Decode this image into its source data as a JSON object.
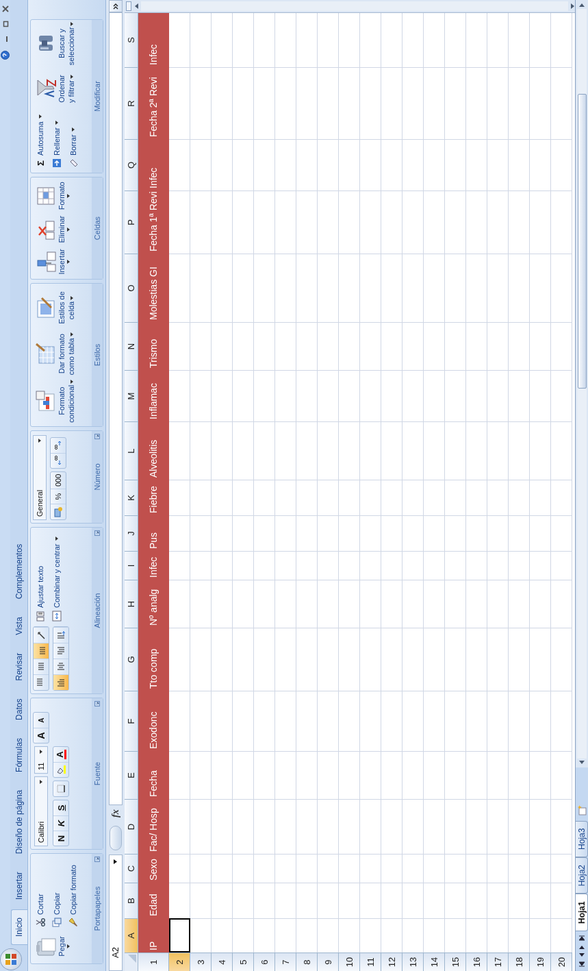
{
  "tabs": [
    {
      "label": "Inicio",
      "selected": true
    },
    {
      "label": "Insertar",
      "selected": false
    },
    {
      "label": "Diseño de página",
      "selected": false
    },
    {
      "label": "Fórmulas",
      "selected": false
    },
    {
      "label": "Datos",
      "selected": false
    },
    {
      "label": "Revisar",
      "selected": false
    },
    {
      "label": "Vista",
      "selected": false
    },
    {
      "label": "Complementos",
      "selected": false
    }
  ],
  "ribbon": {
    "portapapeles": {
      "title": "Portapapeles",
      "launcher": true,
      "paste": "Pegar",
      "items": [
        {
          "kind": "cut",
          "label": "Cortar"
        },
        {
          "kind": "copy",
          "label": "Copiar"
        },
        {
          "kind": "brush",
          "label": "Copiar formato"
        }
      ]
    },
    "fuente": {
      "title": "Fuente",
      "launcher": true,
      "font": "Calibri",
      "size": "11",
      "grow": "A",
      "shrink": "A",
      "styles": [
        {
          "kind": "bold",
          "glyph": "N"
        },
        {
          "kind": "italic",
          "glyph": "K"
        },
        {
          "kind": "underline",
          "glyph": "S"
        }
      ],
      "font_color": "A"
    },
    "alineacion": {
      "title": "Alineación",
      "launcher": true,
      "rows": [
        [
          {
            "kind": "top",
            "selected": false
          },
          {
            "kind": "middle",
            "selected": false
          },
          {
            "kind": "bottom",
            "selected": true
          },
          {
            "kind": "orient",
            "selected": false
          }
        ],
        [
          {
            "kind": "left",
            "selected": true
          },
          {
            "kind": "center",
            "selected": false
          },
          {
            "kind": "right",
            "selected": false
          },
          {
            "kind": "indent",
            "selected": false
          }
        ]
      ],
      "wrap": "Ajustar texto",
      "merge": "Combinar y centrar"
    },
    "numero": {
      "title": "Número",
      "launcher": true,
      "format": "General",
      "percent": "%",
      "thousands": "000"
    },
    "estilos": {
      "title": "Estilos",
      "buttons": [
        {
          "kind": "conditional",
          "lines": [
            "Formato",
            "condicional"
          ]
        },
        {
          "kind": "table",
          "lines": [
            "Dar formato",
            "como tabla"
          ]
        },
        {
          "kind": "cellstyle",
          "lines": [
            "Estilos de",
            "celda"
          ]
        }
      ]
    },
    "celdas": {
      "title": "Celdas",
      "buttons": [
        {
          "kind": "insert",
          "label": "Insertar"
        },
        {
          "kind": "delete",
          "label": "Eliminar"
        },
        {
          "kind": "format",
          "label": "Formato"
        }
      ]
    },
    "modificar": {
      "title": "Modificar",
      "sigma": "Σ",
      "small": [
        {
          "kind": "sum",
          "label": "Autosuma"
        },
        {
          "kind": "fill",
          "label": "Rellenar"
        },
        {
          "kind": "clear",
          "label": "Borrar"
        }
      ],
      "big": [
        {
          "kind": "sort",
          "lines": [
            "Ordenar",
            "y filtrar"
          ]
        },
        {
          "kind": "find",
          "lines": [
            "Buscar y",
            "seleccionar"
          ]
        }
      ]
    }
  },
  "formula_bar": {
    "name_box": "A2",
    "fx": "fx"
  },
  "columns": [
    {
      "label": "A",
      "selected": true
    },
    {
      "label": "B",
      "selected": false
    },
    {
      "label": "C",
      "selected": false
    },
    {
      "label": "D",
      "selected": false
    },
    {
      "label": "E",
      "selected": false
    },
    {
      "label": "F",
      "selected": false
    },
    {
      "label": "G",
      "selected": false
    },
    {
      "label": "H",
      "selected": false
    },
    {
      "label": "I",
      "selected": false
    },
    {
      "label": "J",
      "selected": false
    },
    {
      "label": "K",
      "selected": false
    },
    {
      "label": "L",
      "selected": false
    },
    {
      "label": "M",
      "selected": false
    },
    {
      "label": "N",
      "selected": false
    },
    {
      "label": "O",
      "selected": false
    },
    {
      "label": "P",
      "selected": false
    },
    {
      "label": "Q",
      "selected": false
    },
    {
      "label": "R",
      "selected": false
    },
    {
      "label": "S",
      "selected": false
    }
  ],
  "rows": [
    {
      "number": "1",
      "selected": false,
      "cells": [
        "IP",
        "Edad",
        "Sexo",
        "Fac/ Hosp",
        "Fecha",
        "Exodonc",
        "Tto comp",
        "Nº analg",
        "Infec",
        "Pus",
        "Fiebre",
        "Alveolitis",
        "Inflamac",
        "Trismo",
        "Molestias GI",
        "Fecha 1ª Revi",
        "Infec",
        "Fecha 2ª Revi",
        "Infec"
      ]
    },
    {
      "number": "2",
      "selected": true,
      "cells": []
    },
    {
      "number": "3",
      "selected": false,
      "cells": []
    },
    {
      "number": "4",
      "selected": false,
      "cells": []
    },
    {
      "number": "5",
      "selected": false,
      "cells": []
    },
    {
      "number": "6",
      "selected": false,
      "cells": []
    },
    {
      "number": "7",
      "selected": false,
      "cells": []
    },
    {
      "number": "8",
      "selected": false,
      "cells": []
    },
    {
      "number": "9",
      "selected": false,
      "cells": []
    },
    {
      "number": "10",
      "selected": false,
      "cells": []
    },
    {
      "number": "11",
      "selected": false,
      "cells": []
    },
    {
      "number": "12",
      "selected": false,
      "cells": []
    },
    {
      "number": "13",
      "selected": false,
      "cells": []
    },
    {
      "number": "14",
      "selected": false,
      "cells": []
    },
    {
      "number": "15",
      "selected": false,
      "cells": []
    },
    {
      "number": "16",
      "selected": false,
      "cells": []
    },
    {
      "number": "17",
      "selected": false,
      "cells": []
    },
    {
      "number": "18",
      "selected": false,
      "cells": []
    },
    {
      "number": "19",
      "selected": false,
      "cells": []
    },
    {
      "number": "20",
      "selected": false,
      "cells": []
    }
  ],
  "sheet_tabs": [
    {
      "label": "Hoja1",
      "selected": true
    },
    {
      "label": "Hoja2",
      "selected": false
    },
    {
      "label": "Hoja3",
      "selected": false
    }
  ]
}
